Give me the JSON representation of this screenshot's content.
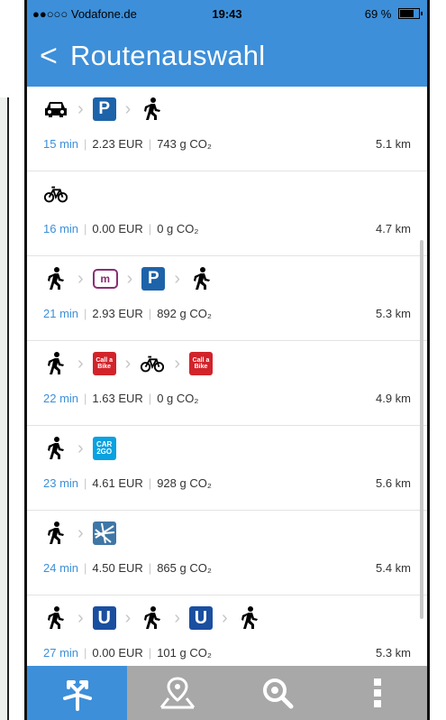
{
  "status": {
    "carrier": "●●○○○ Vodafone.de",
    "time": "19:43",
    "battery": "69 %"
  },
  "nav": {
    "back_label": "<",
    "title": "Routenauswahl"
  },
  "routes": [
    {
      "time": "15 min",
      "cost": "2.23 EUR",
      "co2": "743 g CO₂",
      "distance": "5.1 km",
      "modes": [
        "car-icon",
        "parking-icon",
        "walk-icon"
      ]
    },
    {
      "time": "16 min",
      "cost": "0.00 EUR",
      "co2": "0 g CO₂",
      "distance": "4.7 km",
      "modes": [
        "bike-icon"
      ]
    },
    {
      "time": "21 min",
      "cost": "2.93 EUR",
      "co2": "892 g CO₂",
      "distance": "5.3 km",
      "modes": [
        "walk-icon",
        "ev-charging-icon",
        "parking-icon",
        "walk-icon"
      ]
    },
    {
      "time": "22 min",
      "cost": "1.63 EUR",
      "co2": "0 g CO₂",
      "distance": "4.9 km",
      "modes": [
        "walk-icon",
        "call-a-bike-icon",
        "bike-icon",
        "call-a-bike-icon"
      ]
    },
    {
      "time": "23 min",
      "cost": "4.61 EUR",
      "co2": "928 g CO₂",
      "distance": "5.6 km",
      "modes": [
        "walk-icon",
        "car2go-icon"
      ]
    },
    {
      "time": "24 min",
      "cost": "4.50 EUR",
      "co2": "865 g CO₂",
      "distance": "5.4 km",
      "modes": [
        "walk-icon",
        "map-service-icon"
      ]
    },
    {
      "time": "27 min",
      "cost": "0.00 EUR",
      "co2": "101 g CO₂",
      "distance": "5.3 km",
      "modes": [
        "walk-icon",
        "ubahn-icon",
        "walk-icon",
        "ubahn-icon",
        "walk-icon"
      ]
    }
  ],
  "badges": {
    "parking": "P",
    "ubahn": "U",
    "m": "m",
    "call_a_bike": "Call a Bike",
    "car2go": "CAR 2GO"
  },
  "tabs": [
    {
      "name": "routes-tab-icon",
      "active": true
    },
    {
      "name": "map-pin-tab-icon",
      "active": false
    },
    {
      "name": "search-tab-icon",
      "active": false
    },
    {
      "name": "more-tab-icon",
      "active": false
    }
  ],
  "colors": {
    "accent": "#3d8fd9",
    "tabbar": "#a8a8a8",
    "parking": "#1d63a9",
    "call_a_bike": "#d2232a",
    "car2go": "#0aa1e0"
  }
}
